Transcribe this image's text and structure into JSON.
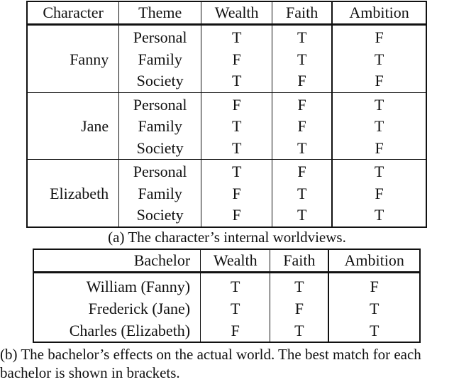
{
  "table_a": {
    "headers": [
      "Character",
      "Theme",
      "Wealth",
      "Faith",
      "Ambition"
    ],
    "groups": [
      {
        "character": "Fanny",
        "rows": [
          {
            "theme": "Personal",
            "wealth": "T",
            "faith": "T",
            "ambition": "F"
          },
          {
            "theme": "Family",
            "wealth": "F",
            "faith": "T",
            "ambition": "T"
          },
          {
            "theme": "Society",
            "wealth": "T",
            "faith": "F",
            "ambition": "F"
          }
        ]
      },
      {
        "character": "Jane",
        "rows": [
          {
            "theme": "Personal",
            "wealth": "F",
            "faith": "F",
            "ambition": "T"
          },
          {
            "theme": "Family",
            "wealth": "T",
            "faith": "F",
            "ambition": "T"
          },
          {
            "theme": "Society",
            "wealth": "T",
            "faith": "T",
            "ambition": "F"
          }
        ]
      },
      {
        "character": "Elizabeth",
        "rows": [
          {
            "theme": "Personal",
            "wealth": "T",
            "faith": "F",
            "ambition": "T"
          },
          {
            "theme": "Family",
            "wealth": "F",
            "faith": "T",
            "ambition": "F"
          },
          {
            "theme": "Society",
            "wealth": "F",
            "faith": "T",
            "ambition": "T"
          }
        ]
      }
    ],
    "caption": "(a) The character’s internal worldviews."
  },
  "table_b": {
    "headers": [
      "Bachelor",
      "Wealth",
      "Faith",
      "Ambition"
    ],
    "rows": [
      {
        "bachelor": "William (Fanny)",
        "wealth": "T",
        "faith": "T",
        "ambition": "F"
      },
      {
        "bachelor": "Frederick (Jane)",
        "wealth": "T",
        "faith": "F",
        "ambition": "T"
      },
      {
        "bachelor": "Charles (Elizabeth)",
        "wealth": "F",
        "faith": "T",
        "ambition": "T"
      }
    ],
    "caption": "(b) The bachelor’s effects on the actual world. The best match for each bachelor is shown in brackets."
  }
}
